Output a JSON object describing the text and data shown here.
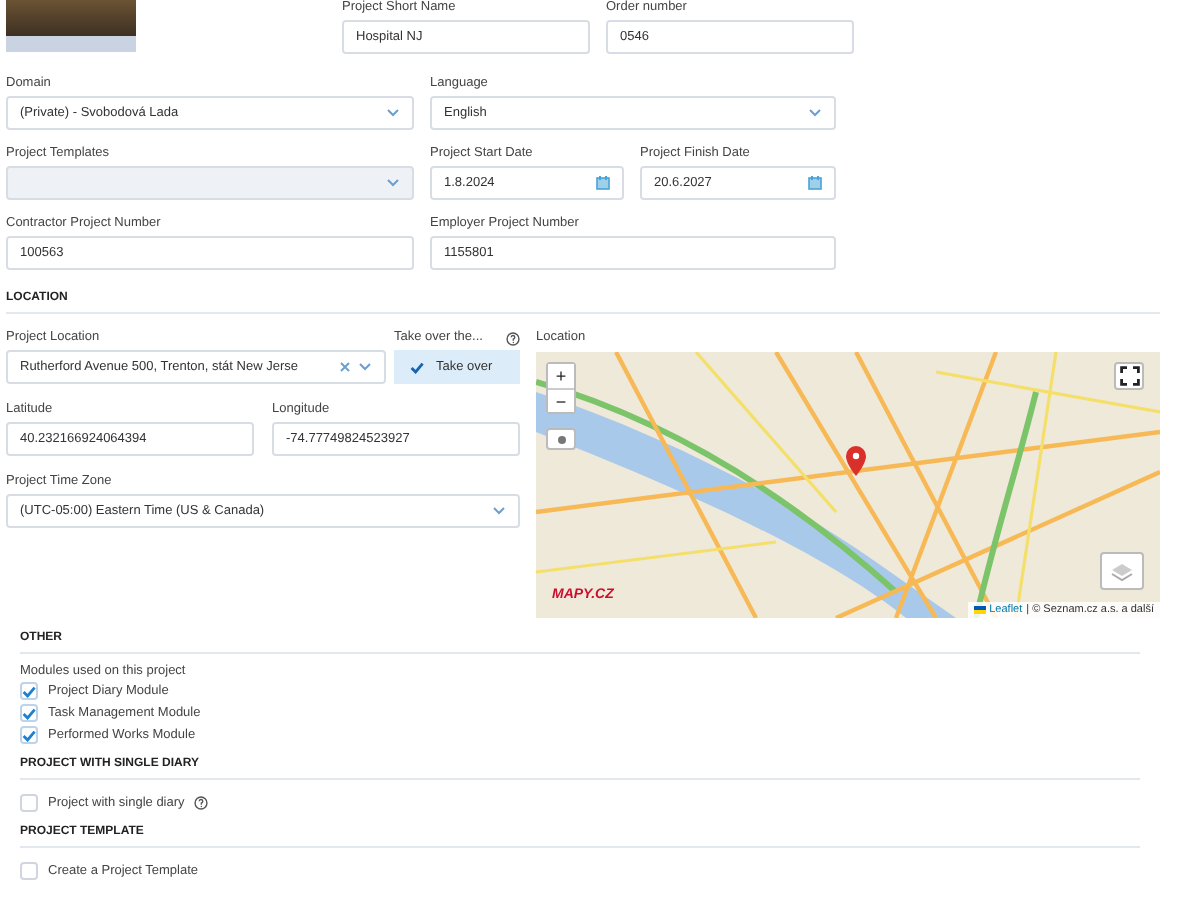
{
  "top_fields": [
    {
      "label": "Project Short Name",
      "value": "Hospital NJ"
    },
    {
      "label": "Order number",
      "value": "0546"
    }
  ],
  "general_fields": [
    {
      "label": "Domain",
      "value": "(Private) - Svobodová Lada",
      "kind": "select",
      "disabled": false
    },
    {
      "label": "Language",
      "value": "English",
      "kind": "select",
      "disabled": false
    },
    {
      "label": "Project Templates",
      "kind": "select",
      "disabled": true
    },
    {
      "label": "Project Start Date",
      "value": "1.8.2024",
      "kind": "date",
      "disabled": false
    },
    {
      "label": "Project Finish Date",
      "value": "20.6.2027",
      "kind": "date",
      "disabled": false
    },
    {
      "label": "Contractor Project Number",
      "value": "100563",
      "kind": "text",
      "disabled": false
    },
    {
      "label": "Employer Project Number",
      "value": "1155801",
      "kind": "text",
      "disabled": false
    }
  ],
  "location": {
    "title": "LOCATION",
    "project_location": {
      "label": "Project Location",
      "value": "Rutherford Avenue 500, Trenton, stát New Jerse"
    },
    "take_over": {
      "label": "Take over the...",
      "button": "Take over"
    },
    "latitude": {
      "label": "Latitude",
      "value": "40.232166924064394"
    },
    "longitude": {
      "label": "Longitude",
      "value": "-74.77749824523927"
    },
    "time_zone": {
      "label": "Project Time Zone",
      "value": "(UTC-05:00) Eastern Time (US & Canada)"
    },
    "map": {
      "label": "Location",
      "zoom_in": "+",
      "zoom_out": "−",
      "logo": "MAPY.CZ",
      "attribution_link": "Leaflet",
      "attribution_text": "| © Seznam.cz a.s. a další"
    }
  },
  "other": {
    "title": "OTHER",
    "modules_label": "Modules used on this project",
    "modules": [
      {
        "label": "Project Diary Module",
        "checked": true
      },
      {
        "label": "Task Management Module",
        "checked": true
      },
      {
        "label": "Performed Works Module",
        "checked": true
      }
    ]
  },
  "single_diary": {
    "title": "PROJECT WITH SINGLE DIARY",
    "option": {
      "label": "Project with single diary",
      "checked": false
    }
  },
  "template": {
    "title": "PROJECT TEMPLATE",
    "option": {
      "label": "Create a Project Template",
      "checked": false
    }
  }
}
